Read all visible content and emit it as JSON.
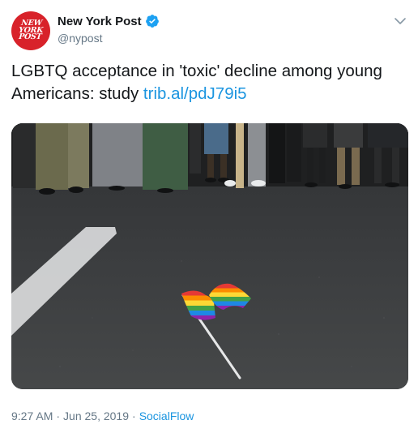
{
  "author": {
    "name": "New York Post",
    "handle": "@nypost",
    "avatar_text": [
      "NEW",
      "YORK",
      "POST"
    ],
    "verified": true
  },
  "tweet": {
    "text": "LGBTQ acceptance in 'toxic' decline among young Americans: study ",
    "link": "trib.al/pdJ79i5"
  },
  "media": {
    "icon": "photo"
  },
  "meta": {
    "time": "9:27 AM",
    "date": "Jun 25, 2019",
    "separator": "·",
    "source": "SocialFlow"
  },
  "colors": {
    "brand_red": "#d8222a",
    "link_blue": "#1b95e0",
    "muted": "#657786"
  }
}
